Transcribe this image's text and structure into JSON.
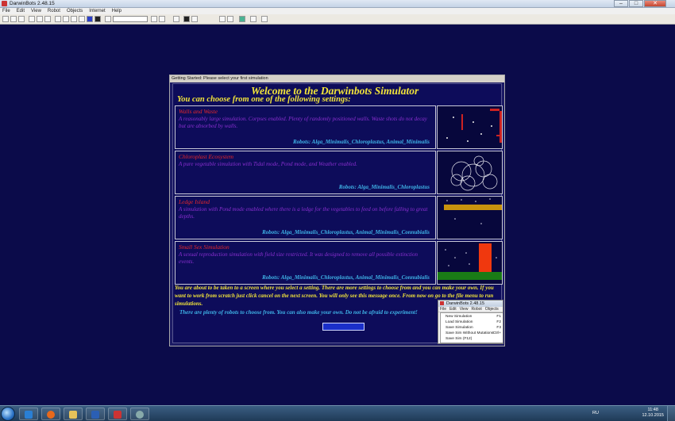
{
  "window": {
    "title": "DarwinBots 2.48.15"
  },
  "menu": [
    "File",
    "Edit",
    "View",
    "Robot",
    "Objects",
    "Internet",
    "Help"
  ],
  "dialog": {
    "title": "Getting Started: Please select your first simulation",
    "heading": "Welcome to the Darwinbots Simulator",
    "subheading": "You can choose from one of the following settings:",
    "settings": [
      {
        "title": "Walls and Waste",
        "description": "A reasonably large simulation. Corpses enabled. Plenty of randomly positioned walls. Waste shots do not decay but are absorbed by walls.",
        "robots": "Robots: Alga_Minimalis_Chloroplastus, Animal_Minimalis"
      },
      {
        "title": "Chloroplast Ecosystem",
        "description": "A pure vegetable simulation with Tidal mode, Pond mode, and Weather enabled.",
        "robots": "Robots: Alga_Minimalis_Chloroplastus"
      },
      {
        "title": "Ledge Island",
        "description": "A simulation with Pond mode enabled where there is a ledge for the vegetables to feed on before falling to great depths.",
        "robots": "Robots:  Alga_Minimalis_Chloroplastus, Animal_Minimalis_Connubialis"
      },
      {
        "title": "Small Sex Simulation",
        "description": "A sexual reproduction simulation with field size restricted. It was designed to remove all possible extinction events.",
        "robots": "Robots:  Alga_Minimalis_Chloroplastus, Animal_Minimalis_Connubialis"
      }
    ],
    "message": "You are about to be taken to a screen where you select a setting. There are more settings to choose from and you can make your own. If you want to work from scratch just click cancel on the next screen. You will only see this message once. From now on go to the file menu to run simulations.",
    "message2": "There are plenty of robots to choose from. You can also make your own. Do not be afraid to experiment!",
    "menu_shot": {
      "title": "DarwinBots 2.48.15",
      "menubar": [
        "File",
        "Edit",
        "View",
        "Robot",
        "Objects"
      ],
      "items": [
        {
          "label": "New Simulation",
          "accel": "F1"
        },
        {
          "label": "Load Simulation",
          "accel": "F2"
        },
        {
          "label": "Save Simulation",
          "accel": "F3"
        },
        {
          "label": "Save Sim Without Mutations",
          "accel": "Ctrl+"
        },
        {
          "label": "Save Sim (F12)",
          "accel": ""
        }
      ]
    }
  },
  "taskbar": {
    "language": "RU",
    "time": "11:48",
    "date": "12.10.2015"
  },
  "colors": {
    "background": "#0b0b4a",
    "heading": "#f2e43a",
    "setting_title": "#e8272b",
    "setting_desc": "#8b2fd1",
    "robots": "#3fb4e8"
  }
}
